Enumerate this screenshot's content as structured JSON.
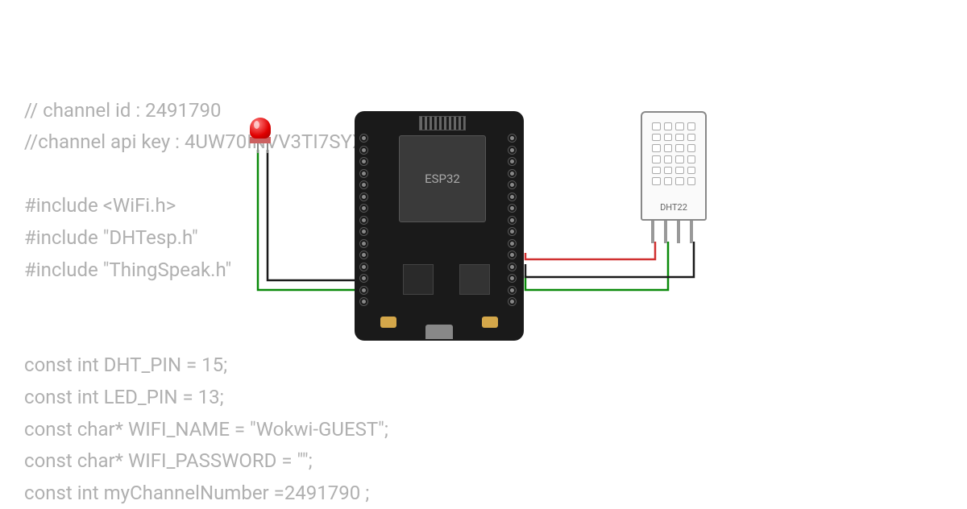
{
  "code": {
    "lines": [
      "// channel id : 2491790",
      "//channel api key : 4UW70INVV3TI7SYX",
      "",
      "#include <WiFi.h>",
      "#include \"DHTesp.h\"",
      "#include \"ThingSpeak.h\"",
      "",
      "",
      "const int DHT_PIN = 15;",
      "const int LED_PIN = 13;",
      "const char* WIFI_NAME = \"Wokwi-GUEST\";",
      "const char* WIFI_PASSWORD = \"\";",
      "const int myChannelNumber =2491790 ;"
    ]
  },
  "components": {
    "mcu": {
      "label": "ESP32"
    },
    "sensor": {
      "label": "DHT22"
    }
  },
  "wires": [
    {
      "color": "#008800",
      "desc": "led-anode-to-gpio13"
    },
    {
      "color": "#1a1a1a",
      "desc": "led-cathode-to-gnd"
    },
    {
      "color": "#e00000",
      "desc": "dht-vcc-to-3v3"
    },
    {
      "color": "#008800",
      "desc": "dht-data-to-gpio15"
    },
    {
      "color": "#1a1a1a",
      "desc": "dht-gnd-to-gnd"
    }
  ]
}
